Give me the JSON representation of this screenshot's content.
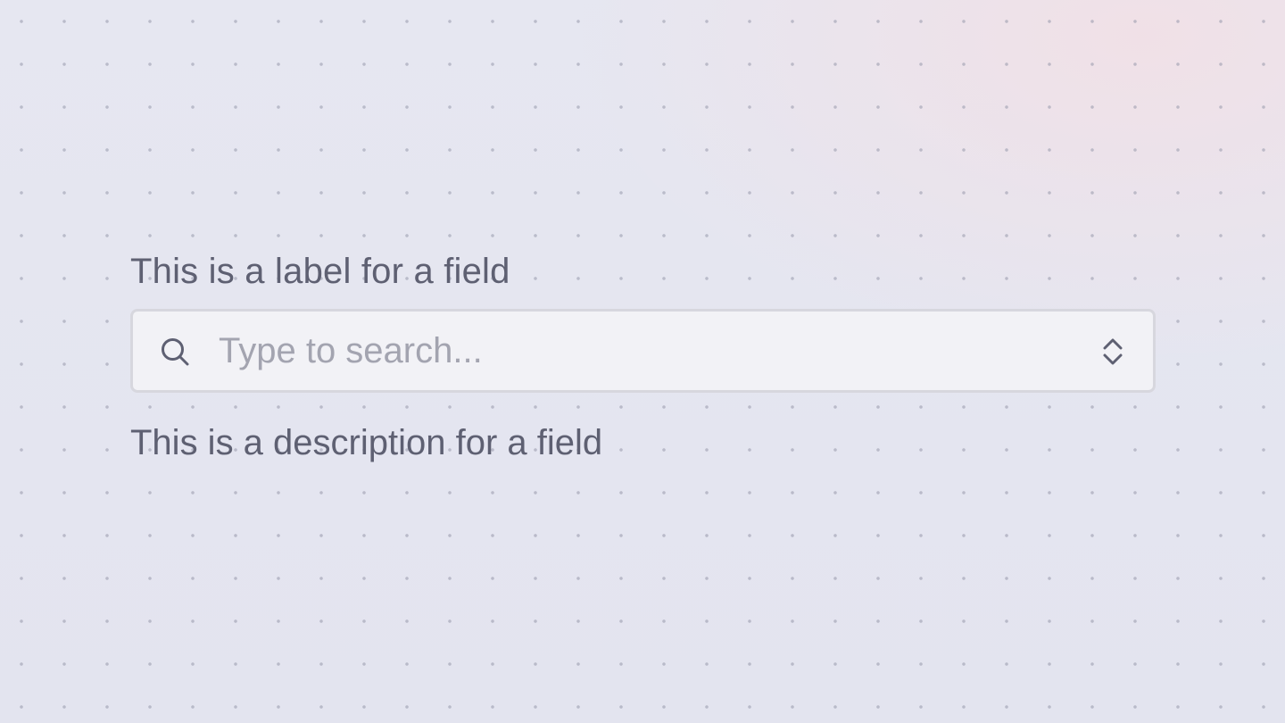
{
  "field": {
    "label": "This is a label for a field",
    "placeholder": "Type to search...",
    "value": "",
    "description": "This is a description for a field",
    "leading_icon": "search-icon",
    "trailing_icon": "chevron-up-down-icon"
  },
  "colors": {
    "text": "#5e6072",
    "placeholder": "#a3a4b0",
    "input_background": "#f2f2f6",
    "input_border": "#d7d7de"
  }
}
